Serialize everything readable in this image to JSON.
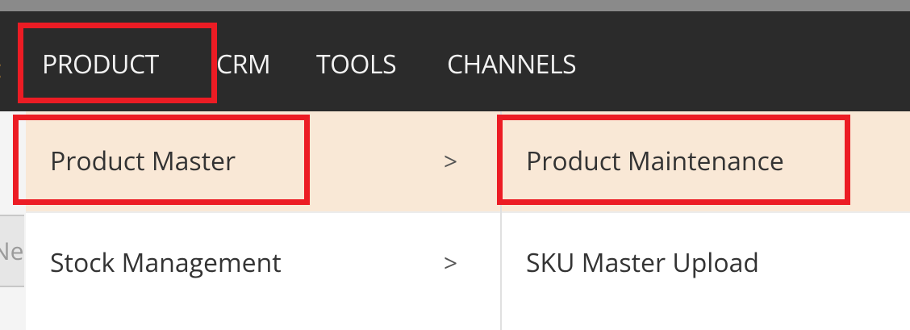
{
  "navbar": {
    "items": [
      {
        "label": "PRODUCT"
      },
      {
        "label": "CRM"
      },
      {
        "label": "TOOLS"
      },
      {
        "label": "CHANNELS"
      }
    ],
    "prev_glyph": ":"
  },
  "submenu": {
    "items": [
      {
        "label": "Product Master",
        "chevron": ">"
      },
      {
        "label": "Stock Management",
        "chevron": ">"
      }
    ]
  },
  "flyout": {
    "items": [
      {
        "label": "Product Maintenance"
      },
      {
        "label": "SKU Master Upload"
      }
    ]
  },
  "left_field": {
    "value": "Ne"
  },
  "colors": {
    "navbar_bg": "#2b2b2b",
    "highlight_border": "#ec1c24",
    "active_item_bg": "#f9e8d6"
  }
}
